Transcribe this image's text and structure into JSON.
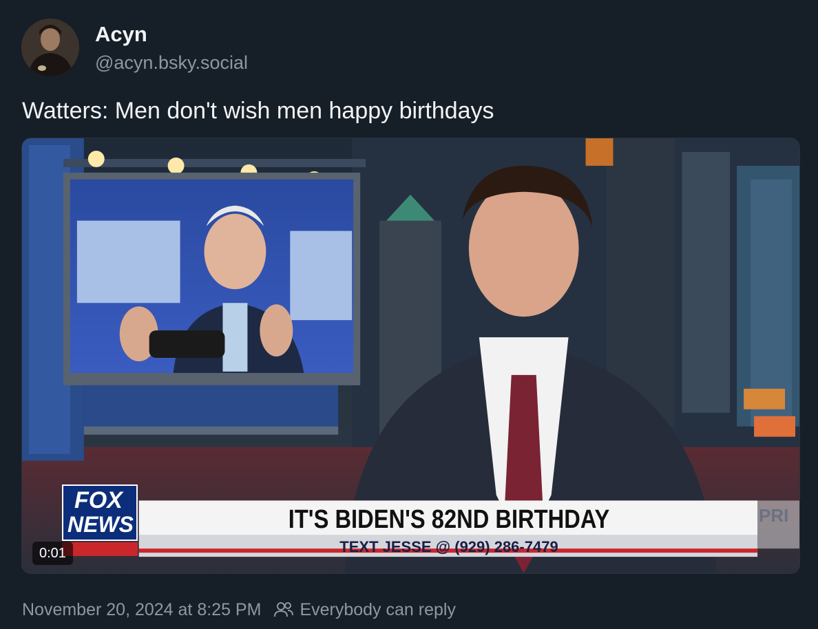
{
  "post": {
    "author": {
      "display_name": "Acyn",
      "handle": "@acyn.bsky.social"
    },
    "text": "Watters: Men don't wish men happy birthdays",
    "video": {
      "elapsed": "0:01",
      "chyron_headline": "IT'S BIDEN'S 82ND BIRTHDAY",
      "chyron_subline": "TEXT JESSE @ (929) 286-7479",
      "network_logo_top": "FOX",
      "network_logo_bottom": "NEWS",
      "background_sign_partial": "PRI"
    },
    "timestamp": "November 20, 2024 at 8:25 PM",
    "reply_setting": "Everybody can reply",
    "reply_icon": "people-icon"
  },
  "colors": {
    "background": "#161e27",
    "text_primary": "#f1f3f5",
    "text_secondary": "#8d98a5",
    "fox_blue": "#0c2e7a",
    "fox_red": "#c9272c"
  }
}
